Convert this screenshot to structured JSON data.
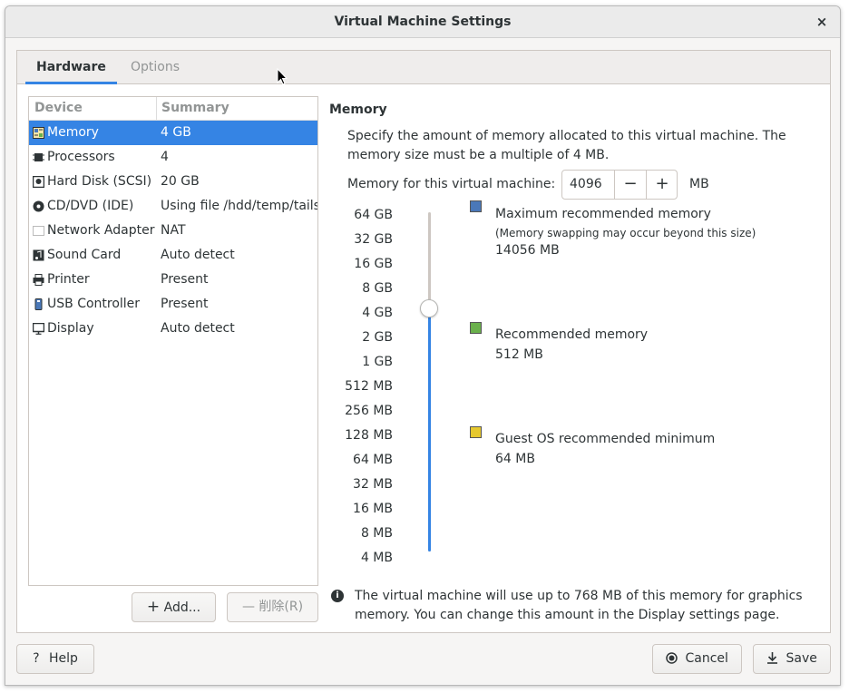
{
  "window": {
    "title": "Virtual Machine Settings",
    "close_glyph": "×"
  },
  "tabs": [
    {
      "label": "Hardware"
    },
    {
      "label": "Options"
    }
  ],
  "device_list": {
    "header_device": "Device",
    "header_summary": "Summary",
    "rows": [
      {
        "name": "Memory",
        "summary": "4 GB",
        "icon": "memory-icon"
      },
      {
        "name": "Processors",
        "summary": "4",
        "icon": "processor-icon"
      },
      {
        "name": "Hard Disk (SCSI)",
        "summary": "20 GB",
        "icon": "hard-disk-icon"
      },
      {
        "name": "CD/DVD (IDE)",
        "summary": "Using file /hdd/temp/tails",
        "icon": "cd-dvd-icon"
      },
      {
        "name": "Network Adapter",
        "summary": "NAT",
        "icon": "network-adapter-icon"
      },
      {
        "name": "Sound Card",
        "summary": "Auto detect",
        "icon": "sound-card-icon"
      },
      {
        "name": "Printer",
        "summary": "Present",
        "icon": "printer-icon"
      },
      {
        "name": "USB Controller",
        "summary": "Present",
        "icon": "usb-controller-icon"
      },
      {
        "name": "Display",
        "summary": "Auto detect",
        "icon": "display-icon"
      }
    ]
  },
  "buttons": {
    "add": "Add...",
    "add_glyph": "+",
    "remove": "削除(R)",
    "remove_glyph": "—",
    "help": "Help",
    "help_glyph": "?",
    "cancel": "Cancel",
    "save": "Save"
  },
  "memory": {
    "title": "Memory",
    "description": "Specify the amount of memory allocated to this virtual machine. The memory size must be a multiple of 4 MB.",
    "field_label": "Memory for this virtual machine:",
    "value": "4096",
    "minus_glyph": "−",
    "plus_glyph": "+",
    "unit": "MB",
    "scale": [
      "64 GB",
      "32 GB",
      "16 GB",
      "8 GB",
      "4 GB",
      "2 GB",
      "1 GB",
      "512 MB",
      "256 MB",
      "128 MB",
      "64 MB",
      "32 MB",
      "16 MB",
      "8 MB",
      "4 MB"
    ],
    "slider_selected": "4 GB",
    "legend": {
      "max_title": "Maximum recommended memory",
      "max_note": "(Memory swapping may occur beyond this size)",
      "max_value": "14056 MB",
      "max_color": "#4a78b8",
      "rec_title": "Recommended memory",
      "rec_value": "512 MB",
      "rec_color": "#6ab04c",
      "min_title": "Guest OS recommended minimum",
      "min_value": "64 MB",
      "min_color": "#e6c82e"
    },
    "info_glyph": "i",
    "info": "The virtual machine will use up to 768 MB of this memory for graphics memory. You can change this amount in the Display settings page."
  },
  "colors": {
    "accent": "#3584e4"
  }
}
